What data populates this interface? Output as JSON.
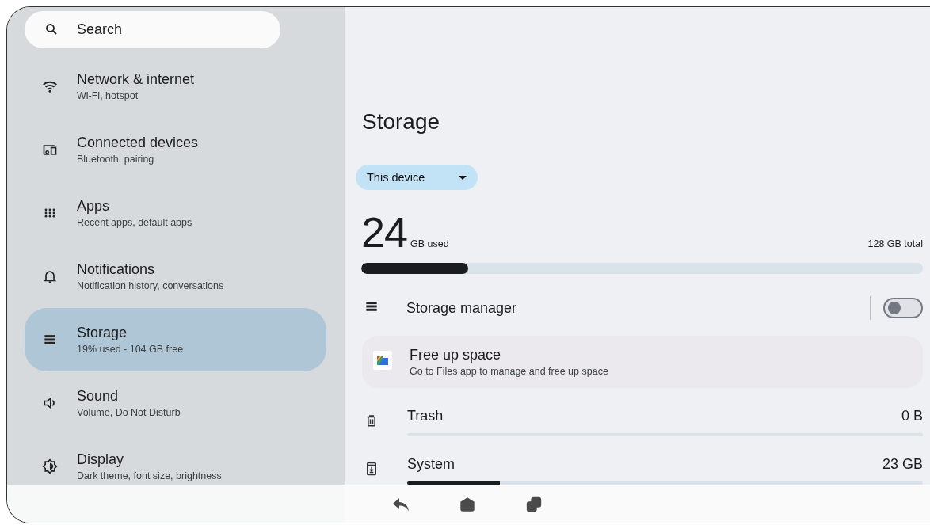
{
  "search": {
    "placeholder": "Search"
  },
  "sidebar": {
    "items": [
      {
        "title": "Network & internet",
        "subtitle": "Wi-Fi, hotspot",
        "selected": false
      },
      {
        "title": "Connected devices",
        "subtitle": "Bluetooth, pairing",
        "selected": false
      },
      {
        "title": "Apps",
        "subtitle": "Recent apps, default apps",
        "selected": false
      },
      {
        "title": "Notifications",
        "subtitle": "Notification history, conversations",
        "selected": false
      },
      {
        "title": "Storage",
        "subtitle": "19% used - 104 GB free",
        "selected": true
      },
      {
        "title": "Sound",
        "subtitle": "Volume, Do Not Disturb",
        "selected": false
      },
      {
        "title": "Display",
        "subtitle": "Dark theme, font size, brightness",
        "selected": false
      }
    ]
  },
  "page": {
    "title": "Storage",
    "volume_dropdown": {
      "value": "This device"
    },
    "usage": {
      "used": "24",
      "used_unit": "GB used",
      "total": "128 GB total",
      "level": 0.19
    },
    "storage_manager": {
      "label": "Storage manager",
      "on": false
    },
    "free_up_space": {
      "title": "Free up space",
      "subtitle": "Go to Files app to manage and free up space"
    },
    "categories": [
      {
        "name": "Trash",
        "size": "0 B",
        "level": 0
      },
      {
        "name": "System",
        "size": "23 GB",
        "level": 0.18
      }
    ]
  }
}
